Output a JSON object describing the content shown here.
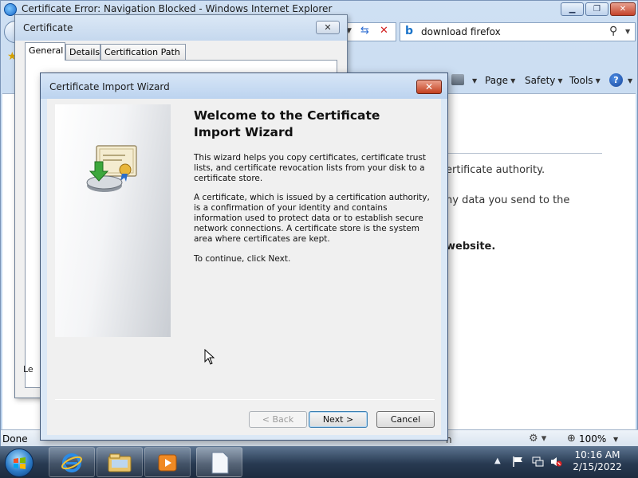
{
  "ie": {
    "title": "Certificate Error: Navigation Blocked - Windows Internet Explorer",
    "search_text": "download firefox",
    "commands": {
      "page": "Page",
      "safety": "Safety",
      "tools": "Tools",
      "help": "?"
    },
    "content": {
      "line1": "ertificate authority.",
      "line2": "ny data you send to the",
      "line3": "website."
    },
    "status": {
      "text": "Done",
      "tail": "n",
      "zoom": "100%"
    }
  },
  "certificate_dialog": {
    "title": "Certificate",
    "tabs": [
      "General",
      "Details",
      "Certification Path"
    ],
    "active_tab": "General",
    "panel_label": "Le"
  },
  "wizard": {
    "title": "Certificate Import Wizard",
    "heading": "Welcome to the Certificate Import Wizard",
    "paragraphs": [
      "This wizard helps you copy certificates, certificate trust lists, and certificate revocation lists from your disk to a certificate store.",
      "A certificate, which is issued by a certification authority, is a confirmation of your identity and contains information used to protect data or to establish secure network connections. A certificate store is the system area where certificates are kept.",
      "To continue, click Next."
    ],
    "buttons": {
      "back": "< Back",
      "next": "Next >",
      "cancel": "Cancel"
    }
  },
  "taskbar": {
    "time": "10:16 AM",
    "date": "2/15/2022"
  },
  "colors": {
    "titlebar": "#c5d8ee",
    "taskbar": "#283a52",
    "close_red": "#c3401f"
  }
}
